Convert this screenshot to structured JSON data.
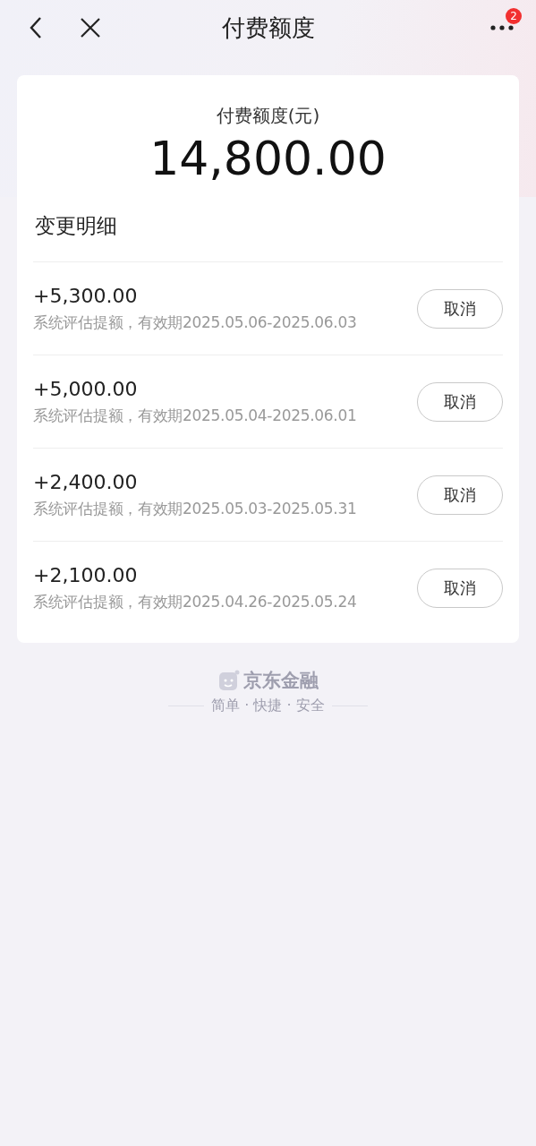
{
  "nav": {
    "title": "付费额度",
    "badge": "2"
  },
  "summary": {
    "label": "付费额度(元)",
    "amount": "14,800.00"
  },
  "details": {
    "title": "变更明细",
    "items": [
      {
        "amount": "+5,300.00",
        "desc": "系统评估提额，有效期2025.05.06-2025.06.03",
        "action": "取消"
      },
      {
        "amount": "+5,000.00",
        "desc": "系统评估提额，有效期2025.05.04-2025.06.01",
        "action": "取消"
      },
      {
        "amount": "+2,400.00",
        "desc": "系统评估提额，有效期2025.05.03-2025.05.31",
        "action": "取消"
      },
      {
        "amount": "+2,100.00",
        "desc": "系统评估提额，有效期2025.04.26-2025.05.24",
        "action": "取消"
      }
    ]
  },
  "footer": {
    "brand": "京东金融",
    "slogan": "简单 · 快捷 · 安全"
  }
}
